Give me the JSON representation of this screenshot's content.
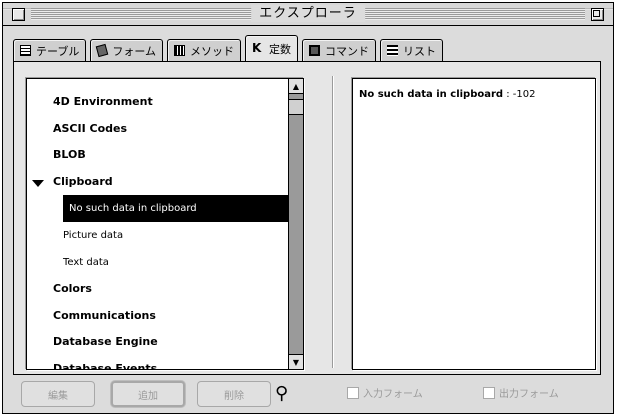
{
  "window": {
    "title": "エクスプローラ"
  },
  "tabs": [
    {
      "label": "テーブル",
      "icon": "table-icon",
      "active": false
    },
    {
      "label": "フォーム",
      "icon": "form-icon",
      "active": false
    },
    {
      "label": "メソッド",
      "icon": "method-icon",
      "active": false
    },
    {
      "label": "定数",
      "icon": "constants-icon",
      "active": true
    },
    {
      "label": "コマンド",
      "icon": "command-icon",
      "active": false
    },
    {
      "label": "リスト",
      "icon": "list-icon",
      "active": false
    }
  ],
  "tree": {
    "items": [
      {
        "label": "4D Environment",
        "type": "folder",
        "expanded": false
      },
      {
        "label": "ASCII Codes",
        "type": "folder",
        "expanded": false
      },
      {
        "label": "BLOB",
        "type": "folder",
        "expanded": false
      },
      {
        "label": "Clipboard",
        "type": "folder",
        "expanded": true
      },
      {
        "label": "No such data in clipboard",
        "type": "child",
        "selected": true
      },
      {
        "label": "Picture data",
        "type": "child",
        "selected": false
      },
      {
        "label": "Text data",
        "type": "child",
        "selected": false
      },
      {
        "label": "Colors",
        "type": "folder",
        "expanded": false
      },
      {
        "label": "Communications",
        "type": "folder",
        "expanded": false
      },
      {
        "label": "Database Engine",
        "type": "folder",
        "expanded": false
      },
      {
        "label": "Database Events",
        "type": "folder",
        "expanded": false
      }
    ]
  },
  "detail": {
    "name": "No such data in clipboard",
    "value": " : -102"
  },
  "buttons": {
    "edit": "編集",
    "add": "追加",
    "delete": "削除"
  },
  "checkboxes": {
    "input_form": "入力フォーム",
    "output_form": "出力フォーム"
  }
}
